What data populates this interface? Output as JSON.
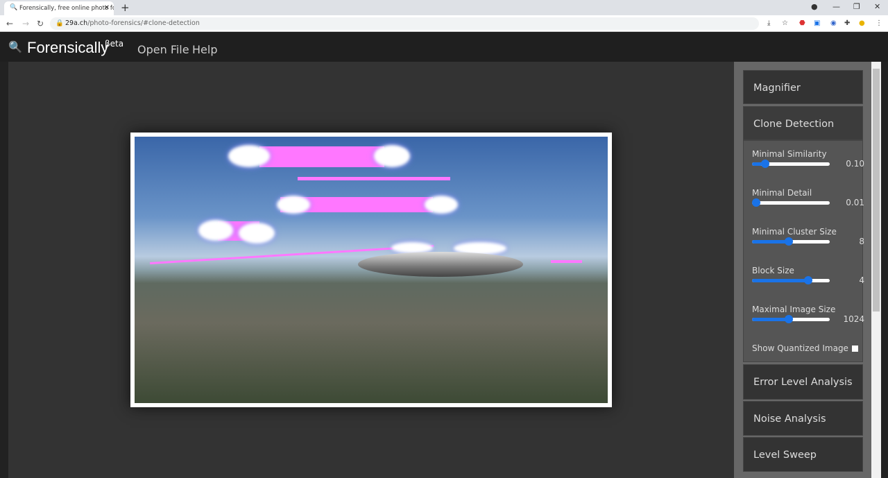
{
  "browser": {
    "tab_title": "Forensically, free online photo fo",
    "url_domain": "29a.ch",
    "url_path": "/photo-forensics/#clone-detection"
  },
  "app": {
    "brand": "Forensically",
    "beta": "βeta",
    "menu": [
      "Open File",
      "Help"
    ]
  },
  "sidebar": {
    "panels_top": [
      "Magnifier",
      "Clone Detection"
    ],
    "clone_detection": {
      "controls": [
        {
          "label": "Minimal Similarity",
          "value": "0.10",
          "fraction": 0.13
        },
        {
          "label": "Minimal Detail",
          "value": "0.01",
          "fraction": 0.0
        },
        {
          "label": "Minimal Cluster Size",
          "value": "8",
          "fraction": 0.47
        },
        {
          "label": "Block Size",
          "value": "4",
          "fraction": 0.75
        },
        {
          "label": "Maximal Image Size",
          "value": "1024",
          "fraction": 0.47
        }
      ],
      "checkbox": {
        "label": "Show Quantized Image",
        "checked": false
      }
    },
    "panels_bottom": [
      "Error Level Analysis",
      "Noise Analysis",
      "Level Sweep"
    ]
  },
  "colors": {
    "accent": "#1a73e8",
    "clone_marker": "#ff77ff"
  }
}
